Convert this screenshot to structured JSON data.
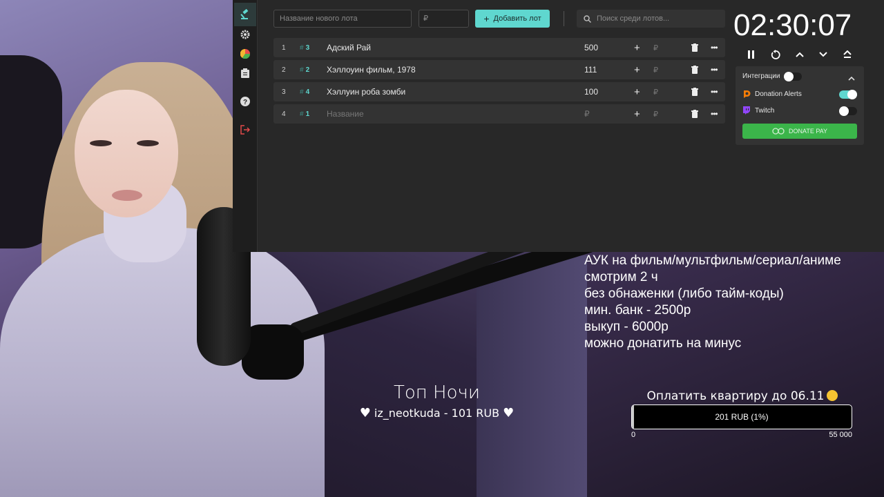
{
  "app": {
    "sidebar": {
      "icons": [
        "gavel-icon",
        "gear-icon",
        "pie-chart-icon",
        "clipboard-icon",
        "help-icon",
        "logout-icon"
      ]
    },
    "new_lot": {
      "name_placeholder": "Название нового лота",
      "price_placeholder": "₽"
    },
    "add_button_label": "Добавить лот",
    "search": {
      "placeholder": "Поиск среди лотов..."
    },
    "lots": [
      {
        "num": "1",
        "id": "3",
        "name": "Адский Рай",
        "amount": "500"
      },
      {
        "num": "2",
        "id": "2",
        "name": "Хэллоуин фильм, 1978",
        "amount": "111"
      },
      {
        "num": "3",
        "id": "4",
        "name": "Хэллуин роба зомби",
        "amount": "100"
      },
      {
        "num": "4",
        "id": "1",
        "name": "Название",
        "amount": "₽"
      }
    ],
    "currency_symbol": "₽"
  },
  "timer": {
    "value": "02:30:07",
    "controls": [
      "pause-icon",
      "restart-icon",
      "chevron-up-icon",
      "chevron-down-icon",
      "eject-icon"
    ]
  },
  "integrations": {
    "title": "Интеграции",
    "enabled": false,
    "items": [
      {
        "label": "Donation Alerts",
        "enabled": true
      },
      {
        "label": "Twitch",
        "enabled": false
      }
    ],
    "donate_pay_label": "DONATE PAY"
  },
  "overlay": {
    "rules": [
      "АУК на фильм/мультфильм/сериал/аниме",
      "смотрим 2 ч",
      "без обнаженки (либо тайм-коды)",
      "мин. банк - 2500р",
      "выкуп - 6000р",
      "можно донатить на минус"
    ],
    "goal": {
      "title": "Оплатить квартиру до 06.11",
      "label": "201 RUB (1%)",
      "progress": 0.01,
      "min": "0",
      "max": "55 000"
    },
    "top_night": {
      "title": "Топ Ночи",
      "donor": "iz_neotkuda - 101 RUB"
    }
  },
  "colors": {
    "accent": "#5fd7cf",
    "panel": "#282828",
    "row": "#333333",
    "donate_pay": "#3bb54a"
  }
}
